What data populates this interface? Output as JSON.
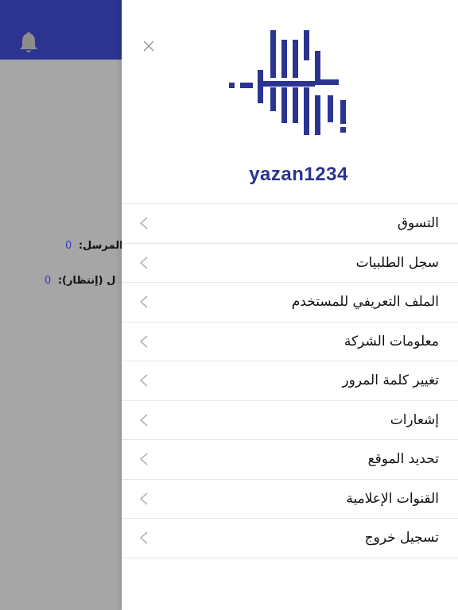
{
  "colors": {
    "brand": "#2b3491",
    "overlay": "#a6a6a6",
    "divider": "#e6e6e6",
    "chevron": "#b3b3b3"
  },
  "background": {
    "header_icon": "bell-icon",
    "line1": {
      "label": "المرسل:",
      "value": "0"
    },
    "line2": {
      "label": "ل (إنتظار):",
      "value": "0"
    }
  },
  "drawer": {
    "close_icon": "close-icon",
    "logo_icon": "brand-logo",
    "username": "yazan1234",
    "items": [
      {
        "label": "التسوق"
      },
      {
        "label": "سجل الطلبيات"
      },
      {
        "label": "الملف التعريفي للمستخدم"
      },
      {
        "label": "معلومات الشركة"
      },
      {
        "label": "تغيير كلمة المرور"
      },
      {
        "label": "إشعارات"
      },
      {
        "label": "تحديد الموقع"
      },
      {
        "label": "القنوات الإعلامية"
      },
      {
        "label": "تسجيل خروج"
      }
    ]
  }
}
